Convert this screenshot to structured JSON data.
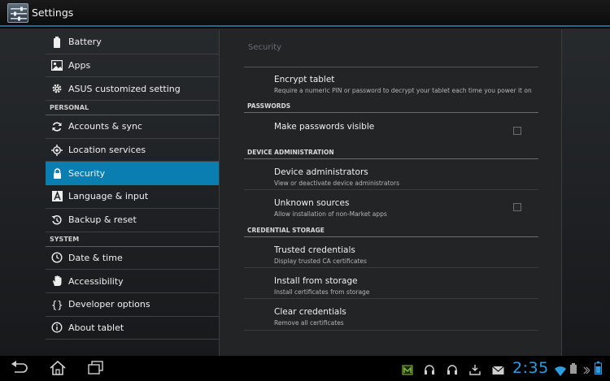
{
  "app": {
    "title": "Settings",
    "icon": "settings-app-icon"
  },
  "sidebar": {
    "items": [
      {
        "label": "Battery",
        "icon": "battery-icon"
      },
      {
        "label": "Apps",
        "icon": "apps-icon"
      },
      {
        "label": "ASUS customized setting",
        "icon": "gear-icon"
      }
    ],
    "personal_header": "PERSONAL",
    "personal_items": [
      {
        "label": "Accounts & sync",
        "icon": "sync-icon"
      },
      {
        "label": "Location services",
        "icon": "location-icon"
      },
      {
        "label": "Security",
        "icon": "lock-icon",
        "active": true
      },
      {
        "label": "Language & input",
        "icon": "language-icon"
      },
      {
        "label": "Backup & reset",
        "icon": "backup-icon"
      }
    ],
    "system_header": "SYSTEM",
    "system_items": [
      {
        "label": "Date & time",
        "icon": "clock-icon"
      },
      {
        "label": "Accessibility",
        "icon": "hand-icon"
      },
      {
        "label": "Developer options",
        "icon": "braces-icon"
      },
      {
        "label": "About tablet",
        "icon": "info-icon"
      }
    ]
  },
  "panel": {
    "title": "Security",
    "encrypt": {
      "title": "Encrypt tablet",
      "subtitle": "Require a numeric PIN or password to decrypt your tablet each time you power it on"
    },
    "passwords_header": "PASSWORDS",
    "make_visible": {
      "title": "Make passwords visible",
      "checked": false
    },
    "device_admin_header": "DEVICE ADMINISTRATION",
    "device_admins": {
      "title": "Device administrators",
      "subtitle": "View or deactivate device administrators"
    },
    "unknown_sources": {
      "title": "Unknown sources",
      "subtitle": "Allow installation of non-Market apps",
      "checked": false
    },
    "credential_header": "CREDENTIAL STORAGE",
    "trusted": {
      "title": "Trusted credentials",
      "subtitle": "Display trusted CA certificates"
    },
    "install": {
      "title": "Install from storage",
      "subtitle": "Install certificates from storage"
    },
    "clear": {
      "title": "Clear credentials",
      "subtitle": "Remove all certificates"
    }
  },
  "statusbar": {
    "time": "2:35",
    "accent": "#2c9ee0",
    "active_color": "#0a7eb0"
  }
}
